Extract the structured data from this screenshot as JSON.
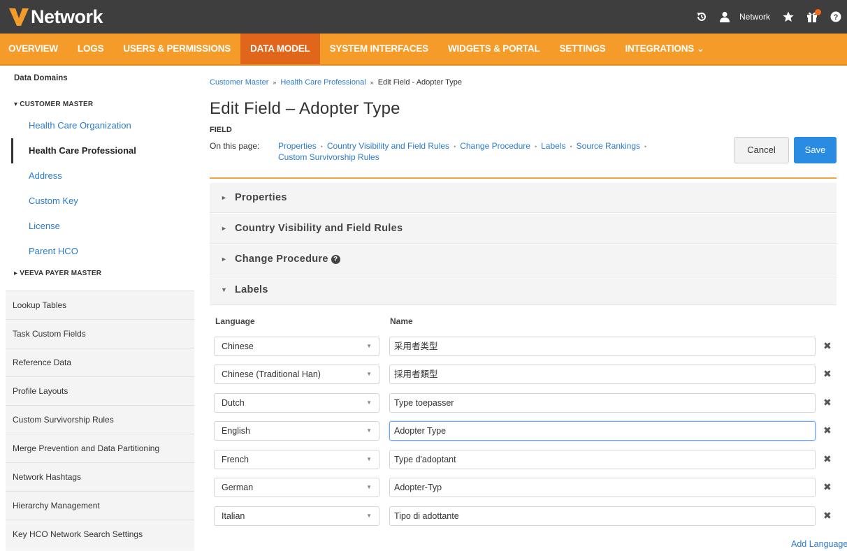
{
  "app": {
    "logo_text": "Network"
  },
  "header": {
    "user_label": "Network"
  },
  "nav": {
    "items": [
      {
        "label": "OVERVIEW"
      },
      {
        "label": "LOGS"
      },
      {
        "label": "USERS & PERMISSIONS"
      },
      {
        "label": "DATA MODEL"
      },
      {
        "label": "SYSTEM INTERFACES"
      },
      {
        "label": "WIDGETS & PORTAL"
      },
      {
        "label": "SETTINGS"
      },
      {
        "label": "INTEGRATIONS ⌄"
      }
    ],
    "active": "DATA MODEL"
  },
  "sidebar": {
    "heading": "Data Domains",
    "customer_master": "▾ CUSTOMER MASTER",
    "links": [
      {
        "label": "Health Care Organization"
      },
      {
        "label": "Health Care Professional"
      },
      {
        "label": "Address"
      },
      {
        "label": "Custom Key"
      },
      {
        "label": "License"
      },
      {
        "label": "Parent HCO"
      }
    ],
    "payer_master": "▸ VEEVA PAYER MASTER",
    "items": [
      {
        "label": "Lookup Tables"
      },
      {
        "label": "Task Custom Fields"
      },
      {
        "label": "Reference Data"
      },
      {
        "label": "Profile Layouts"
      },
      {
        "label": "Custom Survivorship Rules"
      },
      {
        "label": "Merge Prevention and Data Partitioning"
      },
      {
        "label": "Network Hashtags"
      },
      {
        "label": "Hierarchy Management"
      },
      {
        "label": "Key HCO Network Search Settings"
      }
    ]
  },
  "breadcrumb": {
    "items": [
      "Customer Master",
      "Health Care Professional"
    ],
    "current": "Edit Field - Adopter Type",
    "separator": "»"
  },
  "page": {
    "title": "Edit Field – Adopter Type",
    "field_label": "FIELD",
    "on_this_page": "On this page:",
    "links": [
      "Properties",
      "Country Visibility and Field Rules",
      "Change Procedure",
      "Labels",
      "Source Rankings",
      "Custom Survivorship Rules"
    ]
  },
  "buttons": {
    "cancel": "Cancel",
    "save": "Save"
  },
  "sections": [
    {
      "title": "Properties",
      "arrow": "►"
    },
    {
      "title": "Country Visibility and Field Rules",
      "arrow": "►"
    },
    {
      "title": "Change Procedure",
      "arrow": "►"
    },
    {
      "title": "Labels",
      "arrow": "▼"
    }
  ],
  "labels_table": {
    "col_language": "Language",
    "col_name": "Name",
    "rows": [
      {
        "language": "Chinese",
        "name": "采用者类型"
      },
      {
        "language": "Chinese (Traditional Han)",
        "name": "採用者類型"
      },
      {
        "language": "Dutch",
        "name": "Type toepasser"
      },
      {
        "language": "English",
        "name": "Adopter Type"
      },
      {
        "language": "French",
        "name": "Type d'adoptant"
      },
      {
        "language": "German",
        "name": "Adopter-Typ"
      },
      {
        "language": "Italian",
        "name": "Tipo di adottante"
      }
    ],
    "add_language": "Add Language"
  },
  "colors": {
    "header_bg": "#3e3e3e",
    "nav_bg": "#f49b2a",
    "nav_active": "#e0661b",
    "link": "#2a7bd0",
    "save_bg": "#2a8be3"
  }
}
